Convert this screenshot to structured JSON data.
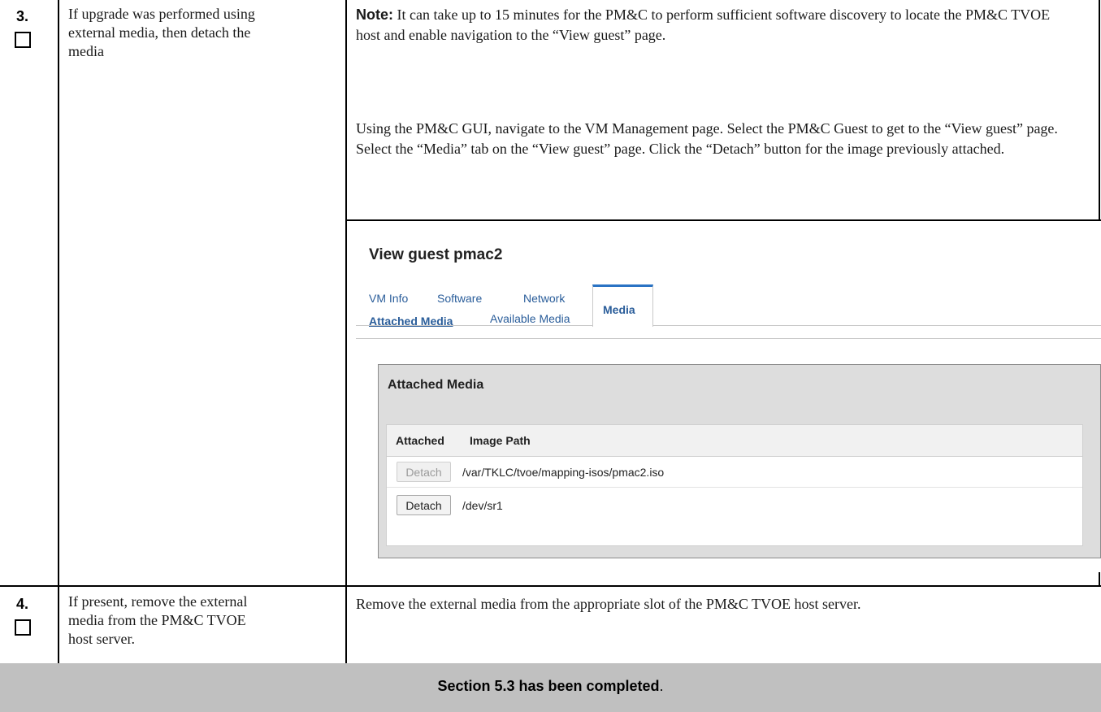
{
  "step3": {
    "number": "3.",
    "description": "If upgrade was performed using external media, then detach the media",
    "note_label": "Note:",
    "note_text": " It can take up to 15 minutes for the PM&C to perform sufficient software discovery to locate the PM&C TVOE host and enable navigation to the “View guest” page.",
    "instructions": "Using the PM&C GUI, navigate to the VM Management page. Select the PM&C Guest to get to the “View guest” page. Select the “Media” tab on the “View guest” page. Click the “Detach” button for the image previously attached."
  },
  "gui": {
    "title": "View guest pmac2",
    "tabs": [
      "VM Info",
      "Software",
      "Network",
      "Media"
    ],
    "active_tab": "Media",
    "subtabs": [
      "Attached Media",
      "Available Media"
    ],
    "active_subtab": "Attached Media",
    "panel_title": "Attached Media",
    "columns": [
      "Attached",
      "Image Path"
    ],
    "rows": [
      {
        "button": "Detach",
        "path": "/var/TKLC/tvoe/mapping-isos/pmac2.iso",
        "disabled": true
      },
      {
        "button": "Detach",
        "path": "/dev/sr1",
        "disabled": false
      }
    ]
  },
  "step4": {
    "number": "4.",
    "description": "If present, remove the external media from the PM&C TVOE host server.",
    "instructions": "Remove the external media from the appropriate slot of the PM&C TVOE host server."
  },
  "footer": {
    "text": "Section 5.3 has been completed",
    "period": "."
  }
}
